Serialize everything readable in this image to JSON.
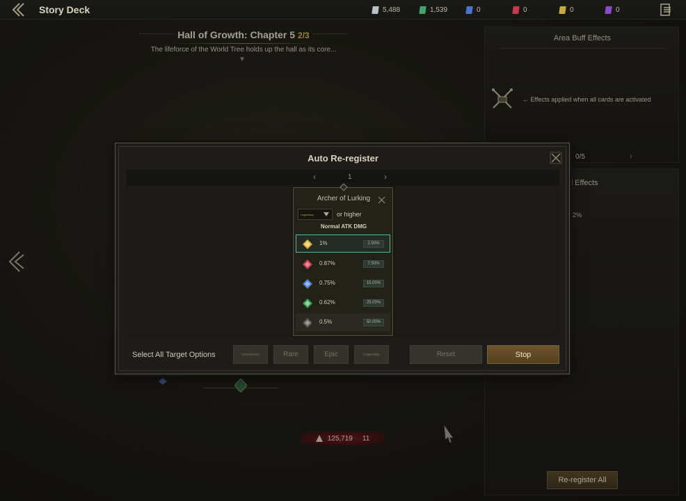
{
  "topbar": {
    "title": "Story Deck",
    "currencies": [
      {
        "name": "white-card",
        "value": "5,488",
        "color": "#b9c2c8"
      },
      {
        "name": "green-card",
        "value": "1,539",
        "color": "#3fa36a"
      },
      {
        "name": "blue-card",
        "value": "0",
        "color": "#4a74c9"
      },
      {
        "name": "red-card",
        "value": "0",
        "color": "#c43a4a"
      },
      {
        "name": "gold-card",
        "value": "0",
        "color": "#c9a93a"
      },
      {
        "name": "purple-card",
        "value": "0",
        "color": "#8a4ac9"
      }
    ]
  },
  "chapter": {
    "title": "Hall of Growth: Chapter 5",
    "progress": "2/3",
    "description": "The lifeforce of the World Tree holds up the hall as its core..."
  },
  "buff_panel": {
    "title": "Area Buff Effects",
    "description": "Effects applied when all cards are activated",
    "count": "0/5"
  },
  "card_panel": {
    "title_partial": "d Effects",
    "value_partial": "2%",
    "reregister_all_label": "Re-register All"
  },
  "power": {
    "value": "125,719",
    "level": "11"
  },
  "modal": {
    "title": "Auto Re-register",
    "page": "1",
    "card": {
      "name": "Archer of Lurking",
      "grade_selected": "Legendary",
      "grade_suffix": "or higher",
      "stat_name": "Normal ATK DMG",
      "options": [
        {
          "value": "1%",
          "probability": "2.50%",
          "tier": "legendary",
          "color": "#d8b23a",
          "selected": true
        },
        {
          "value": "0.87%",
          "probability": "7.50%",
          "tier": "epic",
          "color": "#c7424f",
          "selected": false
        },
        {
          "value": "0.75%",
          "probability": "15.00%",
          "tier": "rare",
          "color": "#4f7fd0",
          "selected": false
        },
        {
          "value": "0.62%",
          "probability": "25.00%",
          "tier": "uncommon",
          "color": "#3f9c55",
          "selected": false
        },
        {
          "value": "0.5%",
          "probability": "50.00%",
          "tier": "common",
          "color": "#8a8a86",
          "selected": false
        }
      ]
    },
    "select_all_label": "Select All Target Options",
    "rarity_buttons": [
      "Uncommon",
      "Rare",
      "Epic",
      "Legendary"
    ],
    "reset_label": "Reset",
    "stop_label": "Stop"
  }
}
